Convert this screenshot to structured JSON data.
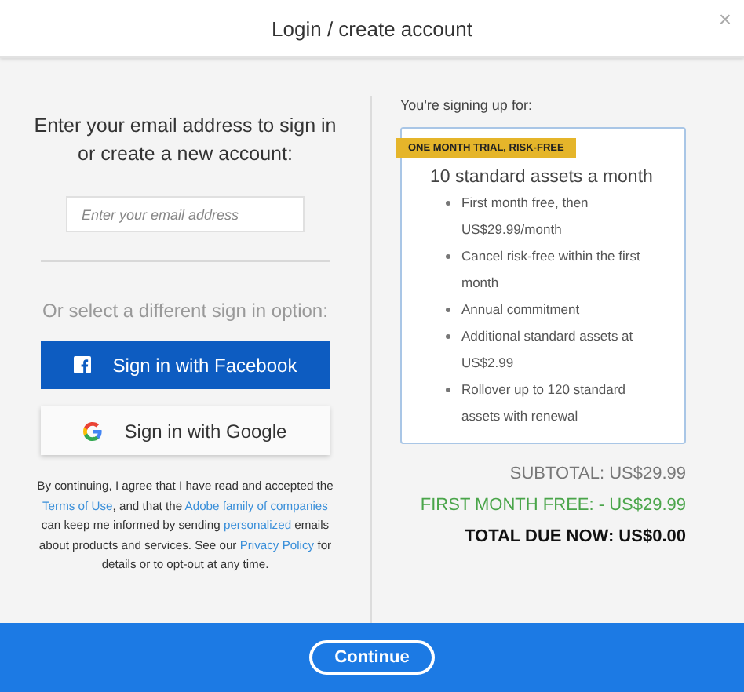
{
  "dialog": {
    "title": "Login / create account",
    "close": "×"
  },
  "signin": {
    "prompt": "Enter your email address to sign in or create a new account:",
    "email": {
      "placeholder": "Enter your email address"
    },
    "alt_label": "Or select a different sign in option:",
    "buttons": [
      {
        "kind": "facebook",
        "label": "Sign in with Facebook"
      },
      {
        "kind": "google",
        "label": "Sign in with Google"
      }
    ],
    "legal": [
      {
        "text": "By continuing, I agree that I have read and accepted the ",
        "link": false
      },
      {
        "text": "Terms of Use",
        "link": true
      },
      {
        "text": ", and that the ",
        "link": false
      },
      {
        "text": "Adobe family of companies",
        "link": true
      },
      {
        "text": " can keep me informed by sending ",
        "link": false
      },
      {
        "text": "personalized",
        "link": true
      },
      {
        "text": " emails about products and services. See our ",
        "link": false
      },
      {
        "text": "Privacy Policy",
        "link": true
      },
      {
        "text": " for details or to opt-out at any time.",
        "link": false
      }
    ]
  },
  "order": {
    "heading": "You're signing up for:",
    "badge": "ONE MONTH TRIAL, RISK-FREE",
    "plan": "10 standard assets a month",
    "features": [
      "First month free, then US$29.99/month",
      "Cancel risk-free within the first month",
      "Annual commitment",
      "Additional standard assets at US$2.99",
      "Rollover up to 120 standard assets with renewal"
    ],
    "totals": [
      {
        "kind": "subtotal",
        "text": "SUBTOTAL: US$29.99"
      },
      {
        "kind": "discount",
        "text": "FIRST MONTH FREE: - US$29.99"
      },
      {
        "kind": "total",
        "text": "TOTAL DUE NOW: US$0.00"
      }
    ]
  },
  "footer": {
    "button": "Continue"
  }
}
